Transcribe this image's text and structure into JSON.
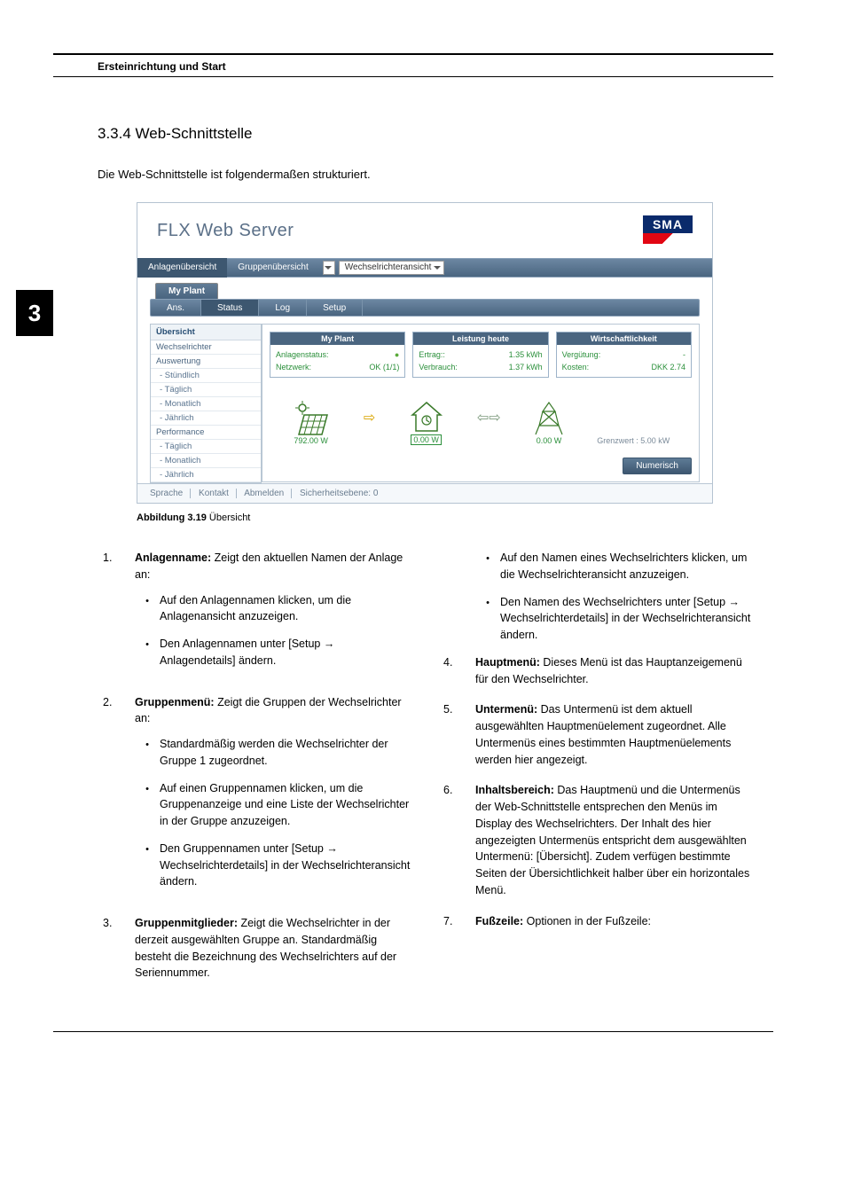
{
  "header": {
    "left": "Ersteinrichtung und Start",
    "right": ""
  },
  "chapter_tab": "3",
  "section_title": "3.3.4  Web-Schnittstelle",
  "intro": "Die Web-Schnittstelle ist folgendermaßen strukturiert.",
  "screenshot": {
    "app_title": "FLX Web Server",
    "logo_text": "SMA",
    "nav": {
      "tab1": "Anlagenübersicht",
      "tab2": "Gruppenübersicht",
      "dd": "Wechselrichteransicht"
    },
    "group_tab": "My Plant",
    "subtabs": {
      "t1": "Ans.",
      "t2": "Status",
      "t3": "Log",
      "t4": "Setup"
    },
    "sidebar": {
      "header": "Übersicht",
      "items": [
        "Wechselrichter",
        "Auswertung",
        "- Stündlich",
        "- Täglich",
        "- Monatlich",
        "- Jährlich",
        "Performance",
        "- Täglich",
        "- Monatlich",
        "- Jährlich"
      ]
    },
    "info": {
      "box1": {
        "title": "My Plant",
        "r1l": "Anlagenstatus:",
        "r1r": "●",
        "r2l": "Netzwerk:",
        "r2r": "OK (1/1)"
      },
      "box2": {
        "title": "Leistung heute",
        "r1l": "Ertrag::",
        "r1r": "1.35 kWh",
        "r2l": "Verbrauch:",
        "r2r": "1.37 kWh"
      },
      "box3": {
        "title": "Wirtschaftlichkeit",
        "r1l": "Vergütung:",
        "r1r": "-",
        "r2l": "Kosten:",
        "r2r": "DKK 2.74"
      }
    },
    "diagram": {
      "gen": "792.00 W",
      "house": "0.00 W",
      "grid1": "0.00 W",
      "limit": "Grenzwert : 5.00 kW"
    },
    "num_button": "Numerisch",
    "footer": {
      "a": "Sprache",
      "b": "Kontakt",
      "c": "Abmelden",
      "d": "Sicherheitsebene: 0"
    }
  },
  "caption_label": "Abbildung 3.19 ",
  "caption_text": "Übersicht",
  "left_col": {
    "i1": {
      "n": "1.",
      "bold": "Anlagenname:",
      "text": " Zeigt den aktuellen Namen der Anlage an:",
      "sub": [
        "Auf den Anlagennamen klicken, um die Anlagenansicht anzuzeigen.",
        "Den Anlagennamen unter [Setup → Anlagendetails] ändern."
      ]
    },
    "i2": {
      "n": "2.",
      "bold": "Gruppenmenü:",
      "text": " Zeigt die Gruppen der Wechsel­richter an:",
      "sub": [
        "Standardmäßig werden die Wechsel­richter der Gruppe 1 zugeordnet.",
        "Auf einen Gruppennamen klicken, um die Gruppenanzeige und eine Liste der Wechselrichter in der Gruppe anzuzeigen.",
        "Den Gruppennamen unter [Setup → Wechselrichterdetails] in der Wechsel­richteransicht ändern."
      ]
    },
    "i3": {
      "n": "3.",
      "bold": "Gruppenmitglieder:",
      "text": " Zeigt die Wechselrichter in der derzeit ausgewählten Gruppe an. Standardmäßig besteht die Bezeichnung des Wechselrichters auf der Seriennummer."
    }
  },
  "right_col": {
    "cont_sub": [
      "Auf den Namen eines Wechselrichters klicken, um die Wechselrichteransicht anzuzeigen.",
      "Den Namen des Wechselrichters unter [Setup → Wechselrichterdetails] in der Wechselrichteransicht ändern."
    ],
    "i4": {
      "n": "4.",
      "bold": "Hauptmenü:",
      "text": " Dieses Menü ist das Hauptanzei­gemenü für den Wechselrichter."
    },
    "i5": {
      "n": "5.",
      "bold": "Untermenü:",
      "text": " Das Untermenü ist dem aktuell ausgewählten Hauptmenüelement zugeordnet. Alle Untermenüs eines bestimmten Hauptmenüe­lements werden hier angezeigt."
    },
    "i6": {
      "n": "6.",
      "bold": "Inhaltsbereich:",
      "text": " Das Hauptmenü und die Untermenüs der Web-Schnittstelle entsprechen den Menüs im Display des Wechselrichters. Der Inhalt des hier angezeigten Untermenüs entspricht dem ausgewählten Untermenü: [Übersicht]. Zudem verfügen bestimmte Seiten der Übersichtlichkeit halber über ein horizontales Menü."
    },
    "i7": {
      "n": "7.",
      "bold": "Fußzeile:",
      "text": " Optionen in der Fußzeile:"
    }
  }
}
